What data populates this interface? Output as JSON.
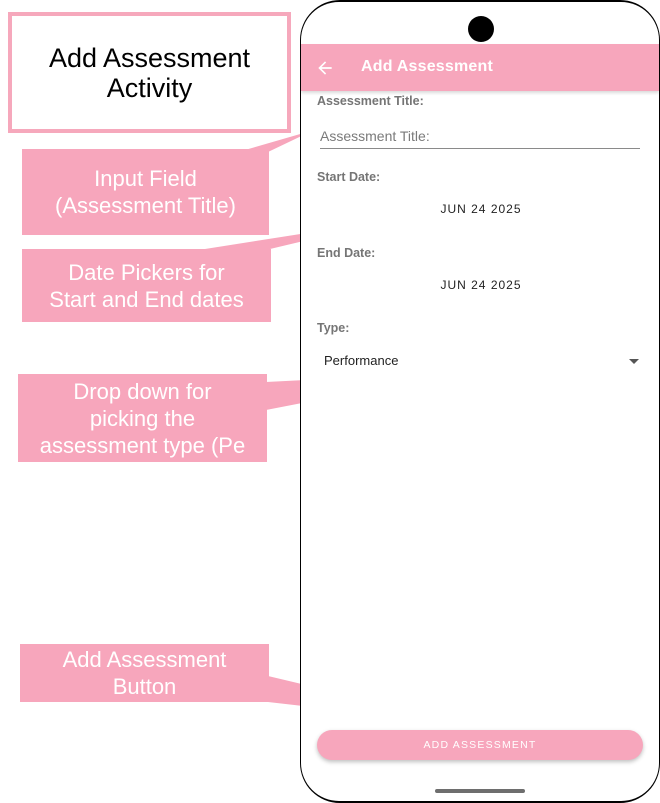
{
  "annotation_title": "Add Assessment\nActivity",
  "callouts": {
    "input_field": "Input Field\n(Assessment Title)",
    "date_pickers": "Date Pickers for\nStart and End dates",
    "dropdown": "Drop down for\npicking the\nassessment  type (Pe",
    "add_button": "Add Assessment\nButton"
  },
  "app": {
    "appbar_title": "Add Assessment",
    "back_icon": "arrow-back-icon",
    "assessment_title_label": "Assessment Title:",
    "assessment_title_placeholder": "Assessment Title:",
    "assessment_title_value": "",
    "start_date_label": "Start Date:",
    "start_date_value": "JUN 24 2025",
    "end_date_label": "End Date:",
    "end_date_value": "JUN 24 2025",
    "type_label": "Type:",
    "type_value": "Performance",
    "add_button_label": "ADD ASSESSMENT"
  },
  "colors": {
    "accent_pink": "#f7a6bc",
    "title_border": "#f6a8bc"
  }
}
